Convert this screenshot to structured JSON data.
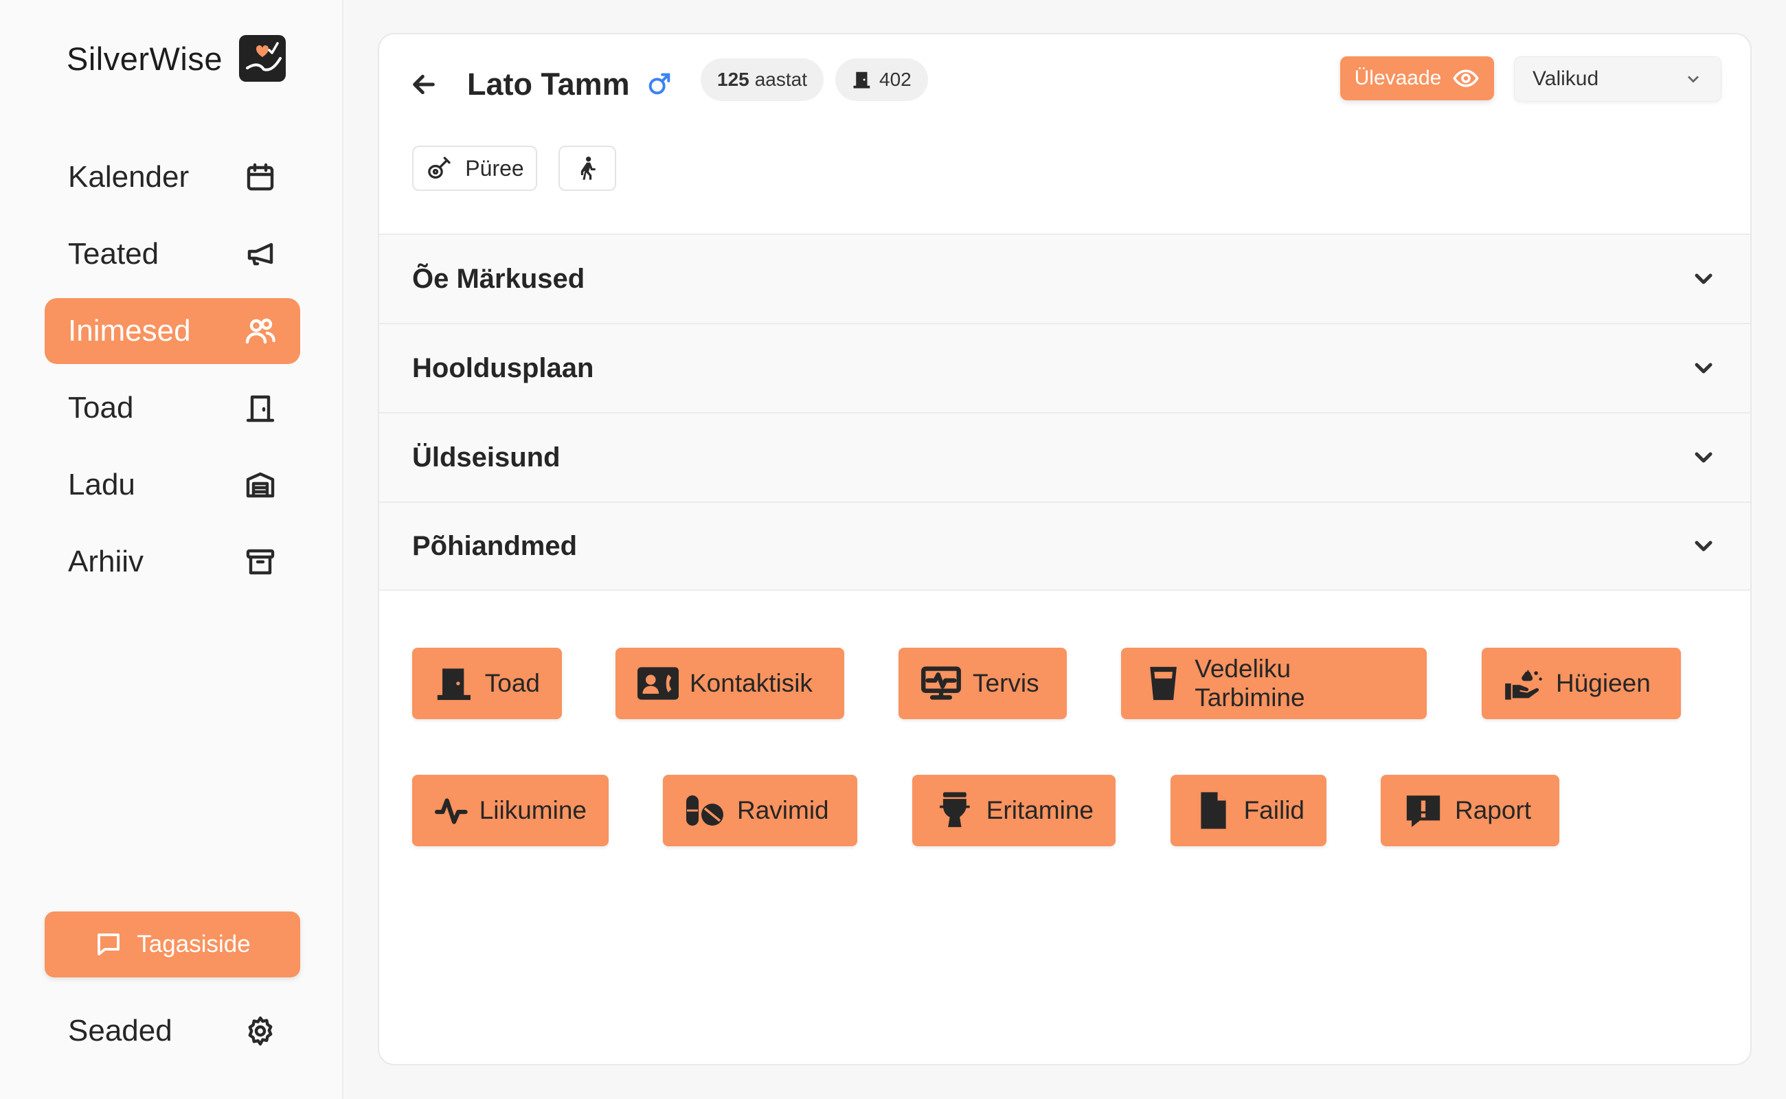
{
  "app": {
    "name": "SilverWise",
    "logo_icon": "heart-check-hand-icon"
  },
  "sidebar": {
    "items": [
      {
        "label": "Kalender",
        "icon": "calendar-icon"
      },
      {
        "label": "Teated",
        "icon": "megaphone-icon"
      },
      {
        "label": "Inimesed",
        "icon": "users-icon",
        "active": true
      },
      {
        "label": "Toad",
        "icon": "door-icon"
      },
      {
        "label": "Ladu",
        "icon": "warehouse-icon"
      },
      {
        "label": "Arhiiv",
        "icon": "archive-icon"
      }
    ],
    "feedback_label": "Tagasiside",
    "settings_label": "Seaded"
  },
  "person": {
    "name": "Lato Tamm",
    "gender_icon": "male-icon",
    "age_value": "125",
    "age_unit": "aastat",
    "room": "402"
  },
  "header": {
    "overview_label": "Ülevaade",
    "options_label": "Valikud",
    "tags": {
      "food_label": "Püree"
    }
  },
  "accordion": [
    {
      "title": "Õe Märkused"
    },
    {
      "title": "Hooldusplaan"
    },
    {
      "title": "Üldseisund"
    },
    {
      "title": "Põhiandmed"
    }
  ],
  "actions": [
    {
      "label": "Toad",
      "icon": "door-icon"
    },
    {
      "label": "Kontaktisik",
      "icon": "contact-card-icon"
    },
    {
      "label": "Tervis",
      "icon": "health-monitor-icon"
    },
    {
      "label": "Vedeliku Tarbimine",
      "icon": "glass-icon"
    },
    {
      "label": "Hügieen",
      "icon": "hand-wash-icon"
    },
    {
      "label": "Liikumine",
      "icon": "pulse-icon"
    },
    {
      "label": "Ravimid",
      "icon": "pills-icon"
    },
    {
      "label": "Eritamine",
      "icon": "toilet-icon"
    },
    {
      "label": "Failid",
      "icon": "file-icon"
    },
    {
      "label": "Raport",
      "icon": "report-alert-icon"
    }
  ],
  "colors": {
    "accent": "#f9935f",
    "gender": "#3b82f6"
  }
}
